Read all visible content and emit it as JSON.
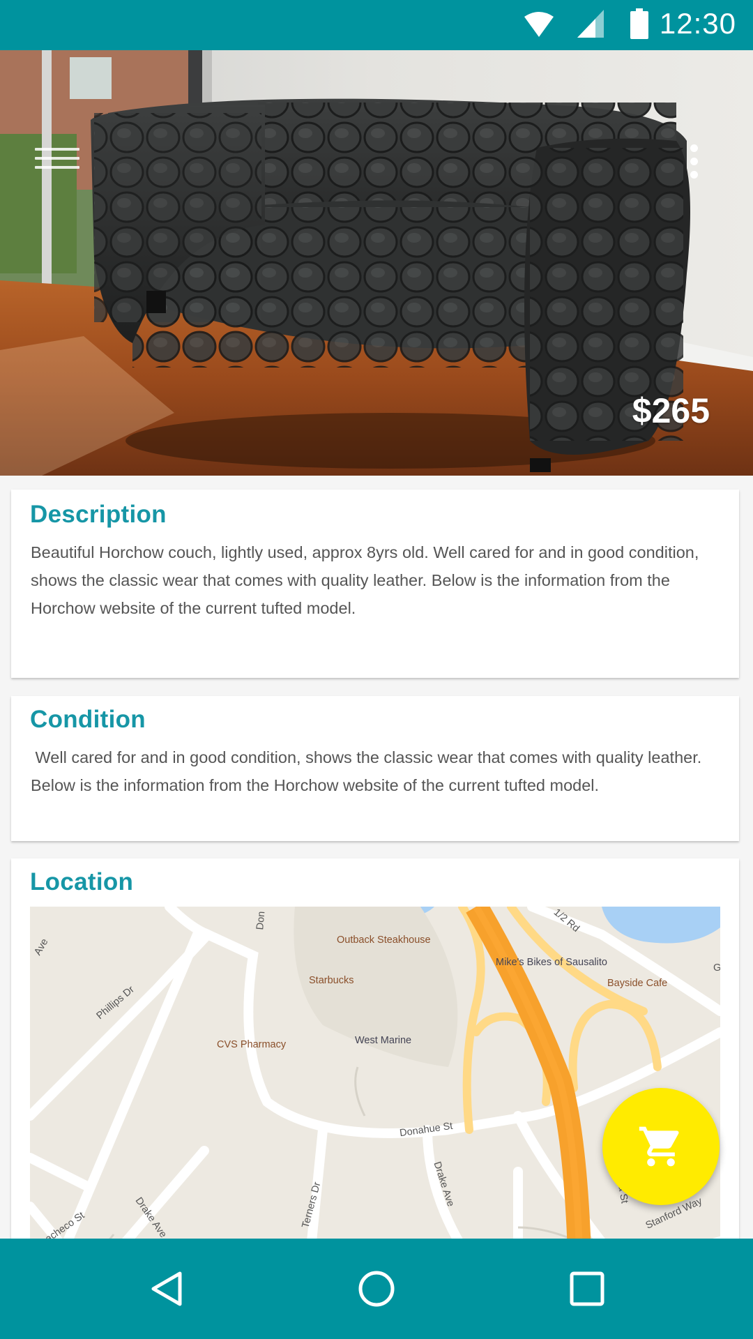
{
  "status_bar": {
    "time": "12:30",
    "icons": [
      "wifi-icon",
      "signal-icon",
      "battery-icon"
    ],
    "color": "#00939e"
  },
  "listing": {
    "price": "$265",
    "image": "black-tufted-leather-couch"
  },
  "description": {
    "title": "Description",
    "body": "Beautiful Horchow couch, lightly used, approx 8yrs old. Well cared for and in good condition, shows the classic wear that comes with quality leather. Below is the information from the Horchow website of the current tufted model."
  },
  "condition": {
    "title": "Condition",
    "body": " Well cared for and in good condition, shows the classic wear that comes with quality leather. Below is the information from the Horchow website of the current tufted model."
  },
  "location": {
    "title": "Location",
    "map_labels": {
      "outback": "Outback Steakhouse",
      "starbucks": "Starbucks",
      "cvs": "CVS Pharmacy",
      "west_marine": "West Marine",
      "mikes_bikes": "Mike's Bikes of Sausalito",
      "bayside": "Bayside Cafe",
      "phillips": "Phillips Dr",
      "donahue": "Donahue St",
      "drake1": "Drake Ave",
      "drake2": "Drake Ave",
      "terners": "Terners Dr",
      "olima": "Olima St",
      "stanford": "Stanford Way",
      "pacheco": "acheco St",
      "half_rd": "1/2 Rd",
      "ave_top": "Ave",
      "don": "Don",
      "g": "G"
    }
  },
  "fab": {
    "icon": "shopping-cart-icon",
    "color": "#ffeb00"
  },
  "nav_bar": {
    "buttons": [
      "back-icon",
      "home-icon",
      "recents-icon"
    ],
    "color": "#00939e"
  },
  "colors": {
    "accent": "#1696a6",
    "primary": "#00939e",
    "fab": "#ffeb00"
  }
}
